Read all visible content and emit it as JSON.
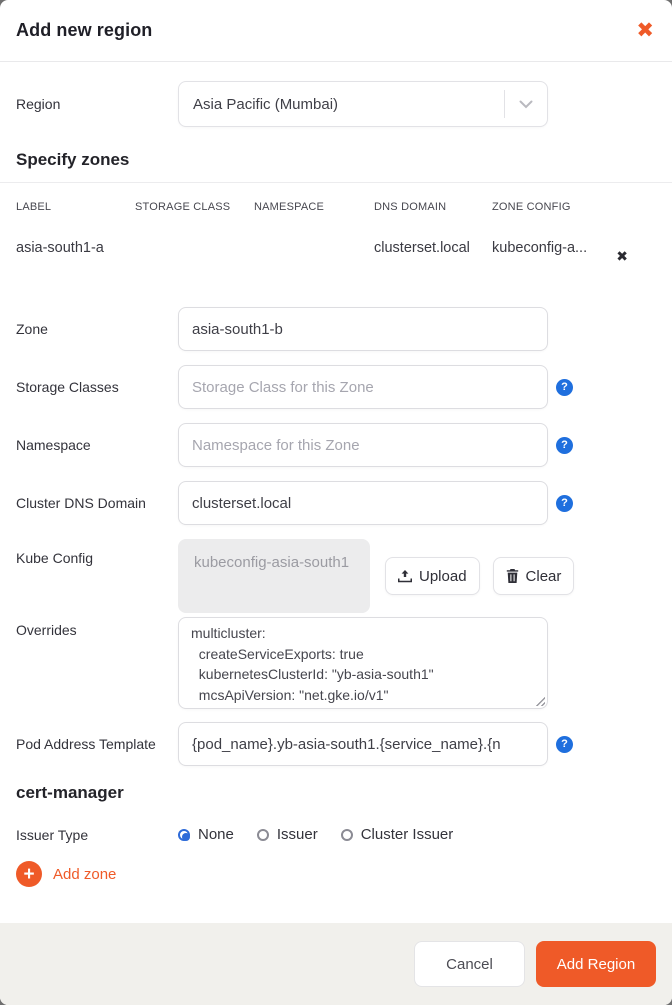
{
  "accent_color": "#EF5A28",
  "modal": {
    "title": "Add new region",
    "close_icon": "✖"
  },
  "region_field": {
    "label": "Region",
    "value": "Asia Pacific (Mumbai)"
  },
  "zones_section": {
    "heading": "Specify zones",
    "table": {
      "columns": [
        "LABEL",
        "STORAGE CLASS",
        "NAMESPACE",
        "DNS DOMAIN",
        "ZONE CONFIG"
      ],
      "rows": [
        {
          "label": "asia-south1-a",
          "storage_class": "",
          "namespace": "",
          "dns_domain": "clusterset.local",
          "zone_config": "kubeconfig-a...",
          "delete_icon": "✖"
        }
      ]
    }
  },
  "zone_form": {
    "zone": {
      "label": "Zone",
      "value": "asia-south1-b"
    },
    "storage_classes": {
      "label": "Storage Classes",
      "placeholder": "Storage Class for this Zone"
    },
    "namespace": {
      "label": "Namespace",
      "placeholder": "Namespace for this Zone"
    },
    "cluster_dns_domain": {
      "label": "Cluster DNS Domain",
      "value": "clusterset.local"
    },
    "kube_config": {
      "label": "Kube Config",
      "file_name": "kubeconfig-asia-south1",
      "upload_label": "Upload",
      "clear_label": "Clear"
    },
    "overrides": {
      "label": "Overrides",
      "value": "multicluster:\n  createServiceExports: true\n  kubernetesClusterId: \"yb-asia-south1\"\n  mcsApiVersion: \"net.gke.io/v1\""
    },
    "pod_address_template": {
      "label": "Pod Address Template",
      "value": "{pod_name}.yb-asia-south1.{service_name}.{n"
    },
    "help_icon": "?"
  },
  "cert_manager": {
    "heading": "cert-manager",
    "issuer_type": {
      "label": "Issuer Type",
      "options": [
        {
          "label": "None",
          "selected": true
        },
        {
          "label": "Issuer",
          "selected": false
        },
        {
          "label": "Cluster Issuer",
          "selected": false
        }
      ]
    }
  },
  "add_zone": {
    "label": "Add zone",
    "plus_icon": "+"
  },
  "footer": {
    "cancel_label": "Cancel",
    "submit_label": "Add Region"
  }
}
